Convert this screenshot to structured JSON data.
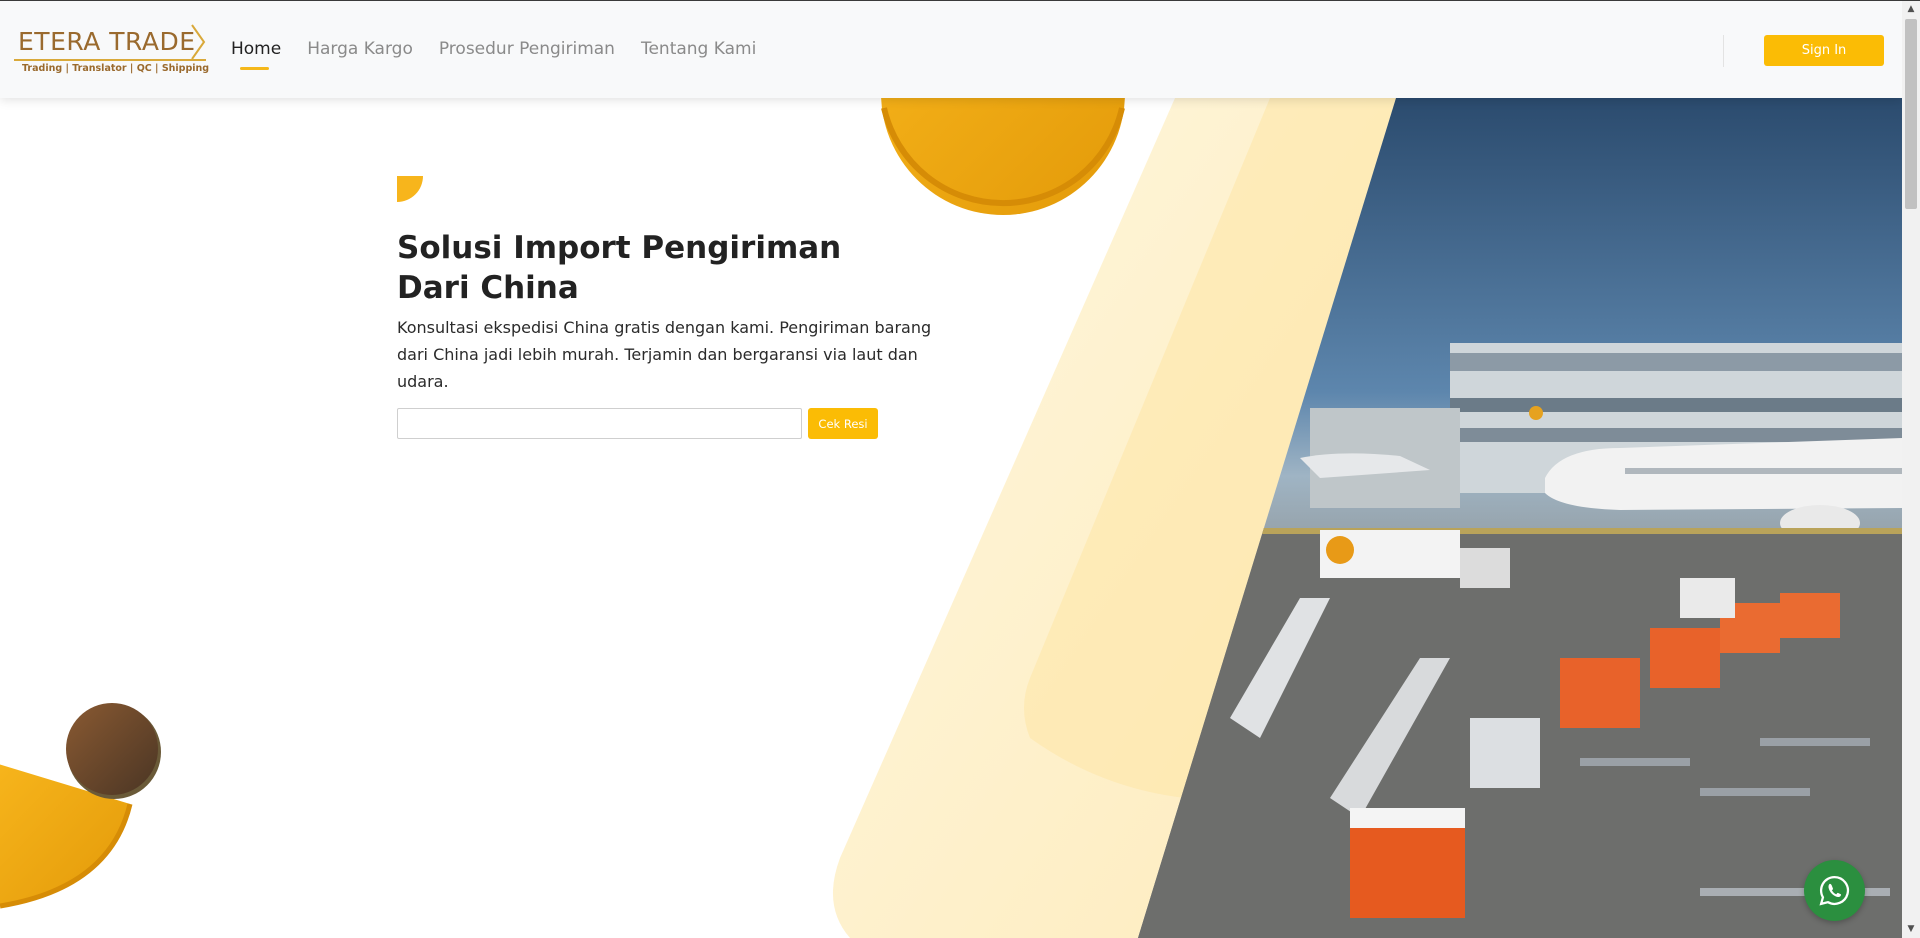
{
  "brand": {
    "name": "ETERA TRADE",
    "tagline": "Trading | Translator | QC | Shipping",
    "colors": {
      "gold": "#9a6a2e",
      "accent": "#fbbc05"
    }
  },
  "nav": {
    "items": [
      {
        "label": "Home",
        "active": true
      },
      {
        "label": "Harga Kargo",
        "active": false
      },
      {
        "label": "Prosedur Pengiriman",
        "active": false
      },
      {
        "label": "Tentang Kami",
        "active": false
      }
    ],
    "signin_label": "Sign In"
  },
  "hero": {
    "title": "Solusi Import Pengiriman Dari China",
    "description": "Konsultasi ekspedisi China gratis dengan kami. Pengiriman barang dari China jadi lebih murah. Terjamin dan bergaransi via laut dan udara.",
    "tracking": {
      "input_value": "",
      "input_placeholder": "",
      "button_label": "Cek Resi"
    },
    "image_description_icon": "airport-photo"
  },
  "floating": {
    "whatsapp_icon": "whatsapp-icon"
  }
}
